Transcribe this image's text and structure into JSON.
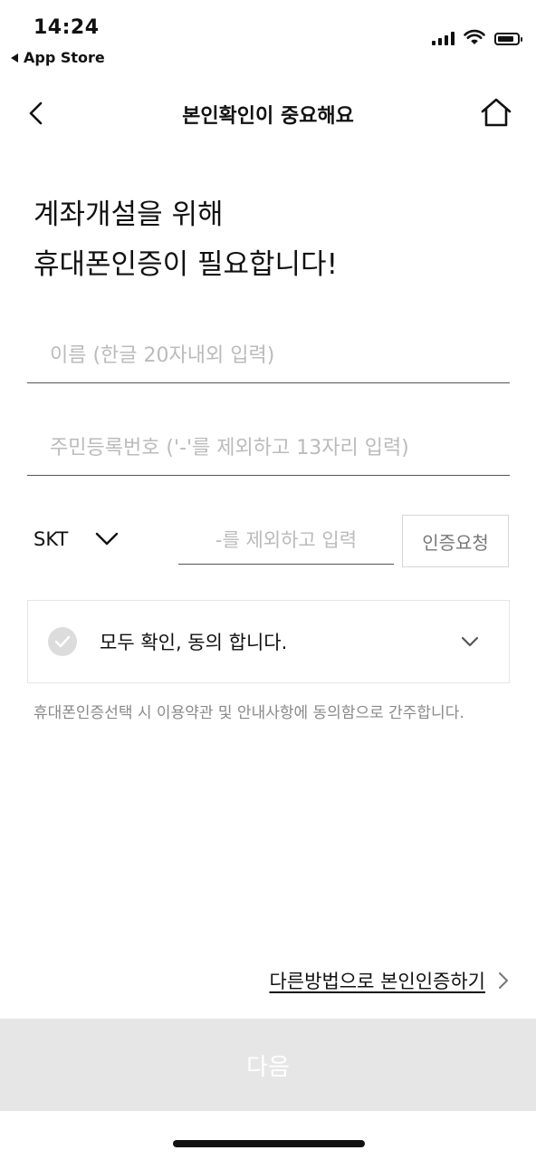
{
  "status_bar": {
    "time": "14:24",
    "back_app": "App Store",
    "icons": [
      "signal-icon",
      "wifi-icon",
      "battery-icon"
    ]
  },
  "nav": {
    "title": "본인확인이 중요해요",
    "back_icon": "chevron-left-icon",
    "home_icon": "home-icon"
  },
  "heading": {
    "line1": "계좌개설을 위해",
    "line2": "휴대폰인증이 필요합니다!"
  },
  "form": {
    "name_placeholder": "이름 (한글 20자내외 입력)",
    "name_value": "",
    "rrn_placeholder": "주민등록번호 ('-'를 제외하고 13자리 입력)",
    "rrn_value": "",
    "carrier": "SKT",
    "phone_placeholder": "-를 제외하고 입력",
    "phone_value": "",
    "verify_label": "인증요청"
  },
  "agreement": {
    "label": "모두 확인, 동의 합니다.",
    "checked": false
  },
  "notice": "휴대폰인증선택 시 이용약관 및 안내사항에 동의함으로 간주합니다.",
  "alt_link": "다른방법으로 본인인증하기",
  "next_label": "다음",
  "colors": {
    "text": "#111111",
    "placeholder": "#bbbbbb",
    "muted": "#8a8a8a",
    "disabled_button": "#e6e6e6",
    "check_inactive": "#dcdcdc"
  }
}
